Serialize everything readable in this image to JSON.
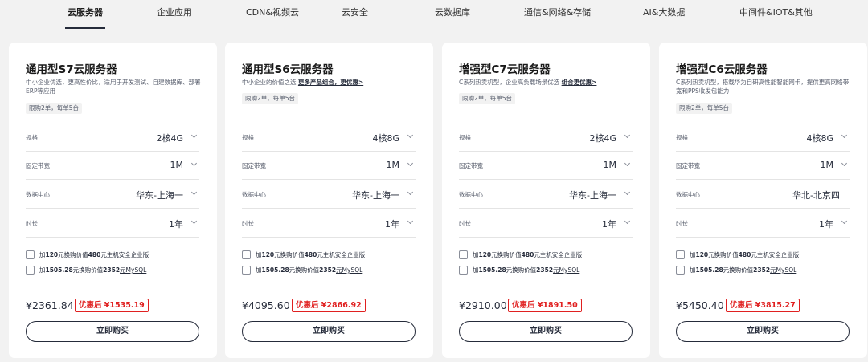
{
  "tabs": [
    {
      "label": "云服务器",
      "active": true
    },
    {
      "label": "企业应用",
      "active": false
    },
    {
      "label": "CDN&视频云",
      "active": false
    },
    {
      "label": "云安全",
      "active": false
    },
    {
      "label": "云数据库",
      "active": false
    },
    {
      "label": "通信&网络&存储",
      "active": false
    },
    {
      "label": "AI&大数据",
      "active": false
    },
    {
      "label": "中间件&IOT&其他",
      "active": false
    }
  ],
  "labels": {
    "spec": "规格",
    "bandwidth": "固定带宽",
    "datacenter": "数据中心",
    "duration": "时长"
  },
  "buy_label": "立即购买",
  "cards": [
    {
      "title": "通用型S7云服务器",
      "desc": "中小企业优选，更高性价比，适用于开发测试、自建数据库、部署ERP等应用",
      "desc_link": "",
      "badge": "限购2单，每单5台",
      "spec": "2核4G",
      "bandwidth": "1M",
      "datacenter": "华东-上海一",
      "duration": "1年",
      "addon1_prefix": "加",
      "addon1_bold": "120",
      "addon1_mid": "元换购价值",
      "addon1_bold2": "480",
      "addon1_link": "元主机安全企业版",
      "addon2_prefix": "加",
      "addon2_bold": "1505.28",
      "addon2_mid": "元换购价值",
      "addon2_bold2": "2352",
      "addon2_link": "元MySQL",
      "price": "¥2361.84",
      "promo": "优惠后 ¥1535.19"
    },
    {
      "title": "通用型S6云服务器",
      "desc": "中小企业的价值之选 ",
      "desc_link": "更多产品组合，更优惠>",
      "badge": "限购2单，每单5台",
      "spec": "4核8G",
      "bandwidth": "1M",
      "datacenter": "华东-上海一",
      "duration": "1年",
      "addon1_prefix": "加",
      "addon1_bold": "120",
      "addon1_mid": "元换购价值",
      "addon1_bold2": "480",
      "addon1_link": "元主机安全企业版",
      "addon2_prefix": "加",
      "addon2_bold": "1505.28",
      "addon2_mid": "元换购价值",
      "addon2_bold2": "2352",
      "addon2_link": "元MySQL",
      "price": "¥4095.60",
      "promo": "优惠后 ¥2866.92"
    },
    {
      "title": "增强型C7云服务器",
      "desc": "C系列热卖机型，企业高负载场景优选 ",
      "desc_link": "组合更优惠>",
      "badge": "限购2单，每单5台",
      "spec": "2核4G",
      "bandwidth": "1M",
      "datacenter": "华东-上海一",
      "duration": "1年",
      "addon1_prefix": "加",
      "addon1_bold": "120",
      "addon1_mid": "元换购价值",
      "addon1_bold2": "480",
      "addon1_link": "元主机安全企业版",
      "addon2_prefix": "加",
      "addon2_bold": "1505.28",
      "addon2_mid": "元换购价值",
      "addon2_bold2": "2352",
      "addon2_link": "元MySQL",
      "price": "¥2910.00",
      "promo": "优惠后 ¥1891.50"
    },
    {
      "title": "增强型C6云服务器",
      "desc": "C系列热卖机型，搭载华为自研高性能智能网卡，提供更高网络带宽和PPS收发包能力",
      "desc_link": "",
      "badge": "限购2单，每单5台",
      "spec": "4核8G",
      "bandwidth": "1M",
      "datacenter": "华北-北京四",
      "duration": "1年",
      "addon1_prefix": "加",
      "addon1_bold": "120",
      "addon1_mid": "元换购价值",
      "addon1_bold2": "480",
      "addon1_link": "元主机安全企业版",
      "addon2_prefix": "加",
      "addon2_bold": "1505.28",
      "addon2_mid": "元换购价值",
      "addon2_bold2": "2352",
      "addon2_link": "元MySQL",
      "price": "¥5450.40",
      "promo": "优惠后 ¥3815.27"
    }
  ]
}
